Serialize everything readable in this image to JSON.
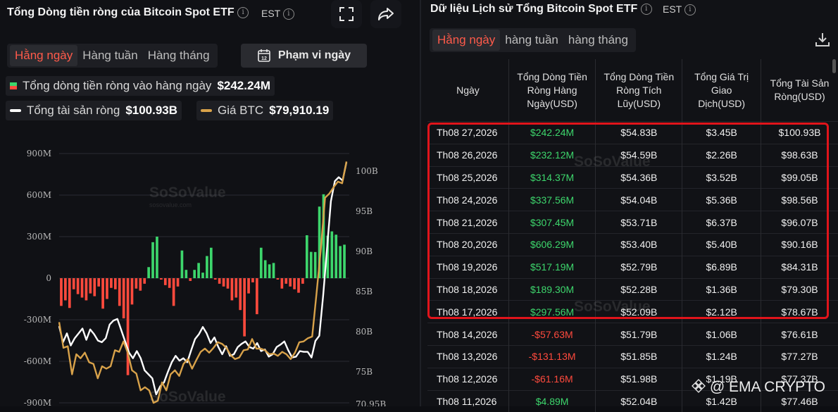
{
  "left": {
    "title": "Tổng Dòng tiền ròng của Bitcoin Spot ETF",
    "timezone": "EST",
    "tabs": [
      "Hằng ngày",
      "Hàng tuần",
      "Hàng tháng"
    ],
    "range_button": "Phạm vi ngày",
    "legend": {
      "daily_flow_label": "Tổng dòng tiền ròng vào hàng ngày",
      "daily_flow_value": "$242.24M",
      "net_assets_label": "Tổng tài sản ròng",
      "net_assets_value": "$100.93B",
      "btc_label": "Giá BTC",
      "btc_value": "$79,910.19"
    },
    "watermark": "SoSoValue",
    "watermark_sub": "sosovalue.com"
  },
  "right": {
    "title": "Dữ liệu Lịch sử Tổng Bitcoin Spot ETF",
    "timezone": "EST",
    "tabs": [
      "Hằng ngày",
      "hàng tuần",
      "hàng tháng"
    ],
    "columns": [
      "Ngày",
      "Tổng Dòng Tiền Ròng Hàng Ngày(USD)",
      "Tổng Dòng Tiền Ròng Tích Lũy(USD)",
      "Tổng Giá Trị Giao Dịch(USD)",
      "Tổng Tài Sản Ròng(USD)"
    ],
    "rows": [
      [
        "Th08 27,2026",
        "$242.24M",
        "$54.83B",
        "$3.45B",
        "$100.93B"
      ],
      [
        "Th08 26,2026",
        "$232.12M",
        "$54.59B",
        "$2.26B",
        "$98.63B"
      ],
      [
        "Th08 25,2026",
        "$314.37M",
        "$54.36B",
        "$3.52B",
        "$99.05B"
      ],
      [
        "Th08 24,2026",
        "$337.56M",
        "$54.04B",
        "$5.36B",
        "$98.56B"
      ],
      [
        "Th08 21,2026",
        "$307.45M",
        "$53.71B",
        "$6.37B",
        "$96.07B"
      ],
      [
        "Th08 20,2026",
        "$606.29M",
        "$53.40B",
        "$5.40B",
        "$90.16B"
      ],
      [
        "Th08 19,2026",
        "$517.19M",
        "$52.79B",
        "$6.89B",
        "$84.31B"
      ],
      [
        "Th08 18,2026",
        "$189.30M",
        "$52.28B",
        "$1.36B",
        "$79.30B"
      ],
      [
        "Th08 17,2026",
        "$297.56M",
        "$52.09B",
        "$2.12B",
        "$78.67B"
      ],
      [
        "Th08 14,2026",
        "-$57.63M",
        "$51.79B",
        "$1.06B",
        "$76.61B"
      ],
      [
        "Th08 13,2026",
        "-$131.13M",
        "$51.85B",
        "$1.24B",
        "$77.27B"
      ],
      [
        "Th08 12,2026",
        "-$61.16M",
        "$51.98B",
        "$1.19B",
        "$77.37B"
      ],
      [
        "Th08 11,2026",
        "$4.89M",
        "$52.04B",
        "$1.42B",
        "$77.46B"
      ]
    ],
    "row_signs": [
      "pos",
      "pos",
      "pos",
      "pos",
      "pos",
      "pos",
      "pos",
      "pos",
      "pos",
      "neg",
      "neg",
      "neg",
      "pos"
    ]
  },
  "credit": "@ EMA CRYPTO",
  "colors": {
    "positive": "#3dd66c",
    "negative": "#ff4a3d",
    "btc": "#d8a24a",
    "assets": "#ffffff",
    "highlight": "#e0141b"
  },
  "chart_data": {
    "type": "bar",
    "title": "Tổng Dòng tiền ròng của Bitcoin Spot ETF",
    "left_axis_ticks": [
      "900M",
      "600M",
      "300M",
      "0",
      "-300M",
      "-600M",
      "-900M"
    ],
    "right_axis_ticks": [
      "100B",
      "95B",
      "90B",
      "85B",
      "80B",
      "75B",
      "70.95B"
    ],
    "ylim_left": [
      -900,
      900
    ],
    "ylim_right": [
      70.95,
      102
    ],
    "grid": true,
    "series": [
      {
        "name": "Tổng dòng tiền ròng vào hàng ngày",
        "type": "bar",
        "unit": "M USD",
        "values": [
          -200,
          -160,
          -215,
          -80,
          -115,
          -140,
          -160,
          -110,
          -130,
          -60,
          -220,
          -150,
          -70,
          -80,
          -200,
          -290,
          -700,
          -190,
          -75,
          -90,
          -40,
          80,
          260,
          300,
          -10,
          -50,
          -70,
          -200,
          -60,
          200,
          60,
          -20,
          60,
          110,
          40,
          160,
          220,
          -10,
          -40,
          -60,
          -75,
          -160,
          -140,
          -230,
          -420,
          -110,
          -30,
          -260,
          220,
          130,
          100,
          110,
          -10,
          -75,
          -40,
          -60,
          -80,
          -105,
          -40,
          310,
          190,
          189,
          517,
          606,
          307,
          338,
          314,
          232,
          242
        ]
      },
      {
        "name": "Tổng tài sản ròng",
        "type": "line",
        "unit": "B USD",
        "axis": "right",
        "values": [
          80.5,
          78.5,
          79.6,
          78.1,
          79.0,
          79.6,
          80.2,
          78.8,
          80.1,
          79.5,
          78.7,
          78.5,
          79.0,
          80.7,
          81.2,
          81.4,
          80.0,
          78.6,
          77.2,
          76.5,
          77.4,
          76.5,
          75.0,
          74.5,
          74.0,
          72.0,
          73.0,
          73.5,
          74.8,
          76.0,
          76.8,
          76.2,
          76.5,
          76.0,
          77.5,
          78.9,
          79.5,
          80.4,
          79.6,
          78.4,
          79.1,
          77.9,
          77.0,
          78.0,
          76.8,
          77.0,
          77.9,
          78.3,
          78.6,
          77.9,
          77.7,
          78.4,
          77.4,
          77.6,
          76.7,
          77.0,
          77.9,
          78.2,
          78.6,
          77.5,
          76.6,
          76.7,
          77.4,
          77.3,
          77.3,
          76.6,
          78.67,
          79.3,
          84.31,
          90.16,
          96.07,
          98.56,
          99.05,
          98.63,
          100.93
        ]
      },
      {
        "name": "Giá BTC",
        "type": "line",
        "unit": "K USD",
        "axis": "right",
        "values": [
          81.0,
          77.8,
          78.0,
          74.5,
          77.0,
          76.5,
          77.2,
          76.0,
          75.8,
          74.0,
          75.5,
          75.2,
          75.5,
          77.5,
          77.3,
          78.6,
          77.2,
          75.0,
          74.6,
          72.5,
          72.9,
          72.5,
          70.95,
          71.2,
          73.5,
          72.5,
          74.5,
          75.0,
          74.3,
          75.8,
          76.4,
          75.2,
          76.3,
          77.3,
          77.7,
          77.2,
          77.8,
          78.5,
          78.3,
          77.8,
          76.9,
          76.4,
          76.6,
          77.5,
          77.6,
          78.9,
          77.7,
          77.7,
          77.5,
          77.0,
          77.1,
          76.8,
          77.3,
          77.0,
          76.4,
          77.2,
          78.5,
          78.6,
          79.0,
          79.2,
          84.5,
          90.0,
          96.5,
          97.0,
          97.8,
          98.5,
          98.3,
          101.0
        ]
      }
    ]
  }
}
